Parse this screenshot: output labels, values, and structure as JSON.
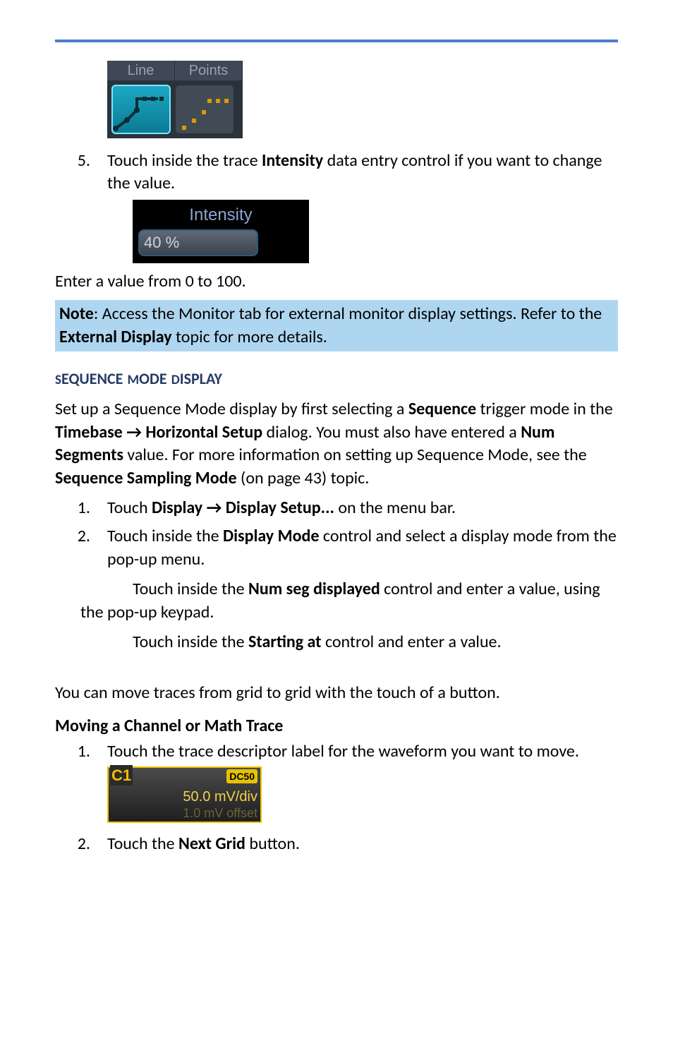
{
  "lp": {
    "tab_line": "Line",
    "tab_points": "Points"
  },
  "step5": {
    "num": "5.",
    "text_a": "Touch inside the trace ",
    "bold_b": "Intensity",
    "text_c": " data entry control if you want to change the value."
  },
  "intensity": {
    "label": "Intensity",
    "value": "40 %"
  },
  "enter_value": "Enter a value from 0 to 100.",
  "note": {
    "bold": "Note",
    "text_a": ": Access the Monitor tab for external monitor display settings. Refer to the ",
    "bold_b": "External Display",
    "text_c": " topic for more details."
  },
  "seq_heading": "Sequence Mode Display",
  "seq_para": {
    "a": "Set up a Sequence Mode display by first selecting a ",
    "b": "Sequence",
    "c": " trigger mode in the ",
    "d": "Timebase → Horizontal Setup",
    "e": "  dialog. You must also have entered a ",
    "f": "Num Segments",
    "g": " value. For more information on setting up Sequence Mode, see the ",
    "h": "Sequence Sampling Mode",
    "i": " (on page 43) topic."
  },
  "seq_step1": {
    "num": "1.",
    "a": "Touch ",
    "b": "Display → Display Setup...",
    "c": " on the menu bar."
  },
  "seq_step2": {
    "num": "2.",
    "a": "Touch inside the ",
    "b": "Display Mode",
    "c": " control and select a display mode from the pop-up menu."
  },
  "seq_sub_a": {
    "a": "Touch inside the ",
    "b": "Num seg displayed",
    "c": " control and enter a value, using the pop-up keypad."
  },
  "seq_sub_b": {
    "a": "Touch inside the ",
    "b": "Starting at",
    "c": " control and enter a value."
  },
  "move_para": "You can move traces from grid to grid with the touch of a button.",
  "move_heading": "Moving a Channel or Math Trace",
  "move_step1": {
    "num": "1.",
    "text": "Touch the trace descriptor label for the waveform you want to move."
  },
  "c1": {
    "label": "C1",
    "dc": "DC50",
    "mv": "50.0 mV/div",
    "off": "1.0 mV offset"
  },
  "move_step2": {
    "num": "2.",
    "a": "Touch the ",
    "b": "Next Grid",
    "c": " button."
  }
}
